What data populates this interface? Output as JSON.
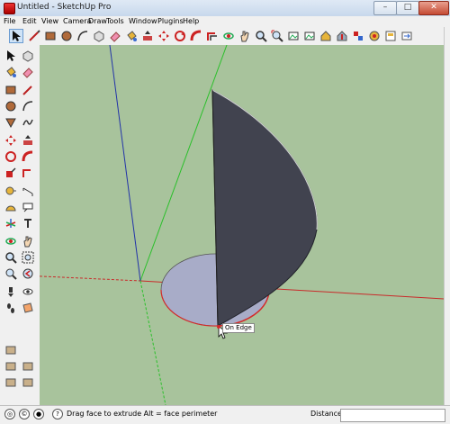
{
  "window": {
    "title": "Untitled - SketchUp Pro",
    "min": "–",
    "max": "□",
    "close": "✕"
  },
  "menu": [
    "File",
    "Edit",
    "View",
    "Camera",
    "Draw",
    "Tools",
    "Window",
    "Plugins",
    "Help"
  ],
  "viewport": {
    "tooltip": "On Edge",
    "colors": {
      "background": "#a8c39c",
      "face_dark": "#41434f",
      "face_light": "#a8acc8",
      "red_axis": "#c92a2a",
      "green_axis": "#2bc02b",
      "blue_axis": "#2233a8"
    }
  },
  "statusbar": {
    "hint": "Drag face to extrude  Alt = face perimeter",
    "measurement_label": "Distance",
    "measurement_value": "",
    "icons": [
      "geolocation-icon",
      "credits-icon",
      "user-icon",
      "help-icon"
    ]
  },
  "top_tools": [
    "select",
    "line",
    "rectangle",
    "circle",
    "arc",
    "make-component",
    "eraser",
    "paint-bucket",
    "push-pull",
    "move",
    "rotate",
    "follow-me",
    "offset",
    "orbit",
    "pan",
    "zoom",
    "zoom-extents",
    "previous-view",
    "next-view",
    "warehouse",
    "share-model",
    "components",
    "extension-warehouse",
    "layout",
    "send-to-layout"
  ],
  "left_tools": [
    "select",
    "make-component",
    "paint-bucket",
    "eraser",
    "rectangle",
    "line",
    "circle",
    "arc",
    "polygon",
    "freehand",
    "move",
    "push-pull",
    "rotate",
    "follow-me",
    "scale",
    "offset",
    "tape-measure",
    "dimension",
    "protractor",
    "text",
    "axes",
    "3d-text",
    "orbit",
    "pan",
    "zoom",
    "zoom-window",
    "zoom-extents",
    "previous",
    "position-camera",
    "walk",
    "look-around",
    "section-plane",
    "warehouse-1",
    "warehouse-2",
    "warehouse-3",
    "warehouse-4",
    "warehouse-5",
    "warehouse-6",
    "sandbox-1",
    "sandbox-2",
    "sandbox-3",
    "sandbox-4"
  ]
}
